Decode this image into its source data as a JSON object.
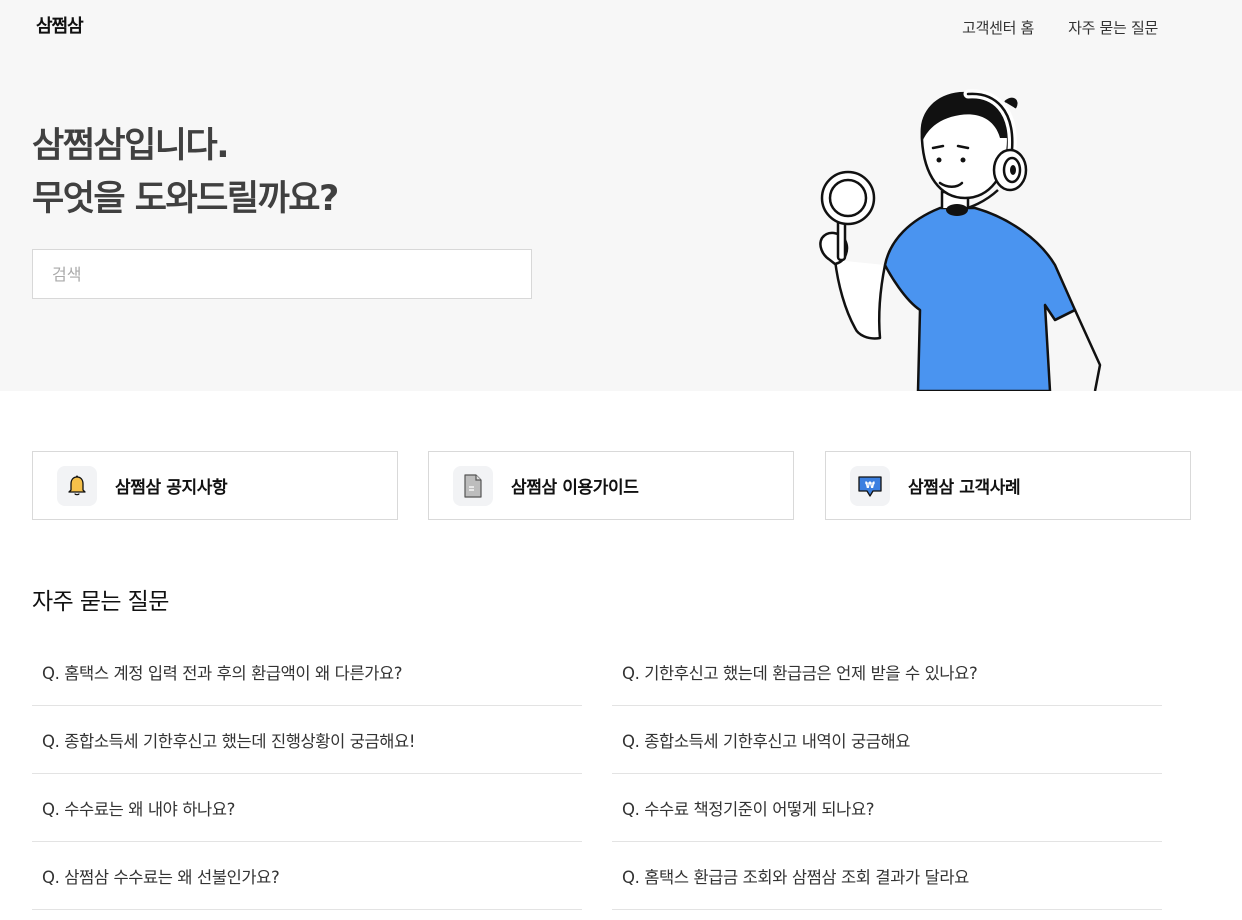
{
  "header": {
    "logo": "삼쩜삼",
    "nav": [
      "고객센터 홈",
      "자주 묻는 질문"
    ]
  },
  "hero": {
    "headline_line1": "삼쩜삼입니다.",
    "headline_line2": "무엇을 도와드릴까요?",
    "search_placeholder": "검색"
  },
  "cards": [
    {
      "label": "삼쩜삼 공지사항",
      "icon": "bell-icon"
    },
    {
      "label": "삼쩜삼 이용가이드",
      "icon": "document-icon"
    },
    {
      "label": "삼쩜삼 고객사례",
      "icon": "won-speech-bubble-icon"
    }
  ],
  "faq": {
    "title": "자주 묻는 질문",
    "left": [
      "Q. 홈택스 계정 입력 전과 후의 환급액이 왜 다른가요?",
      "Q. 종합소득세 기한후신고 했는데 진행상황이 궁금해요!",
      "Q. 수수료는 왜 내야 하나요?",
      "Q. 삼쩜삼 수수료는 왜 선불인가요?"
    ],
    "right": [
      "Q. 기한후신고 했는데 환급금은 언제 받을 수 있나요?",
      "Q. 종합소득세 기한후신고 내역이 궁금해요",
      "Q. 수수료 책정기준이 어떻게 되나요?",
      "Q. 홈택스 환급금 조회와 삼쩜삼 조회 결과가 달라요"
    ]
  },
  "colors": {
    "hero_bg": "#f7f7f7",
    "shirt_blue": "#4a94f0",
    "headline": "#404040"
  }
}
